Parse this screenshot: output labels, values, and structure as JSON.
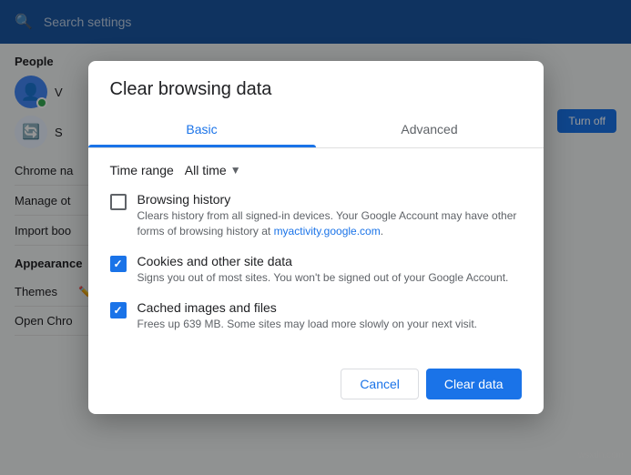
{
  "topbar": {
    "search_placeholder": "Search settings"
  },
  "background": {
    "section_people": "People",
    "section_appearance": "Appearance",
    "row1": "V",
    "row2": "S",
    "chrome_name": "Chrome na",
    "manage_other": "Manage ot",
    "import_boo": "Import boo",
    "themes": "Themes",
    "open_chro": "Open Chro",
    "turn_off_label": "Turn off"
  },
  "dialog": {
    "title": "Clear browsing data",
    "tab_basic": "Basic",
    "tab_advanced": "Advanced",
    "time_range_label": "Time range",
    "time_range_value": "All time",
    "items": [
      {
        "id": "browsing-history",
        "title": "Browsing history",
        "description": "Clears history from all signed-in devices. Your Google Account may have other forms of browsing history at ",
        "link_text": "myactivity.google.com",
        "link_suffix": ".",
        "checked": false
      },
      {
        "id": "cookies",
        "title": "Cookies and other site data",
        "description": "Signs you out of most sites. You won't be signed out of your Google Account.",
        "checked": true
      },
      {
        "id": "cached",
        "title": "Cached images and files",
        "description": "Frees up 639 MB. Some sites may load more slowly on your next visit.",
        "checked": true
      }
    ],
    "cancel_label": "Cancel",
    "clear_label": "Clear data"
  }
}
